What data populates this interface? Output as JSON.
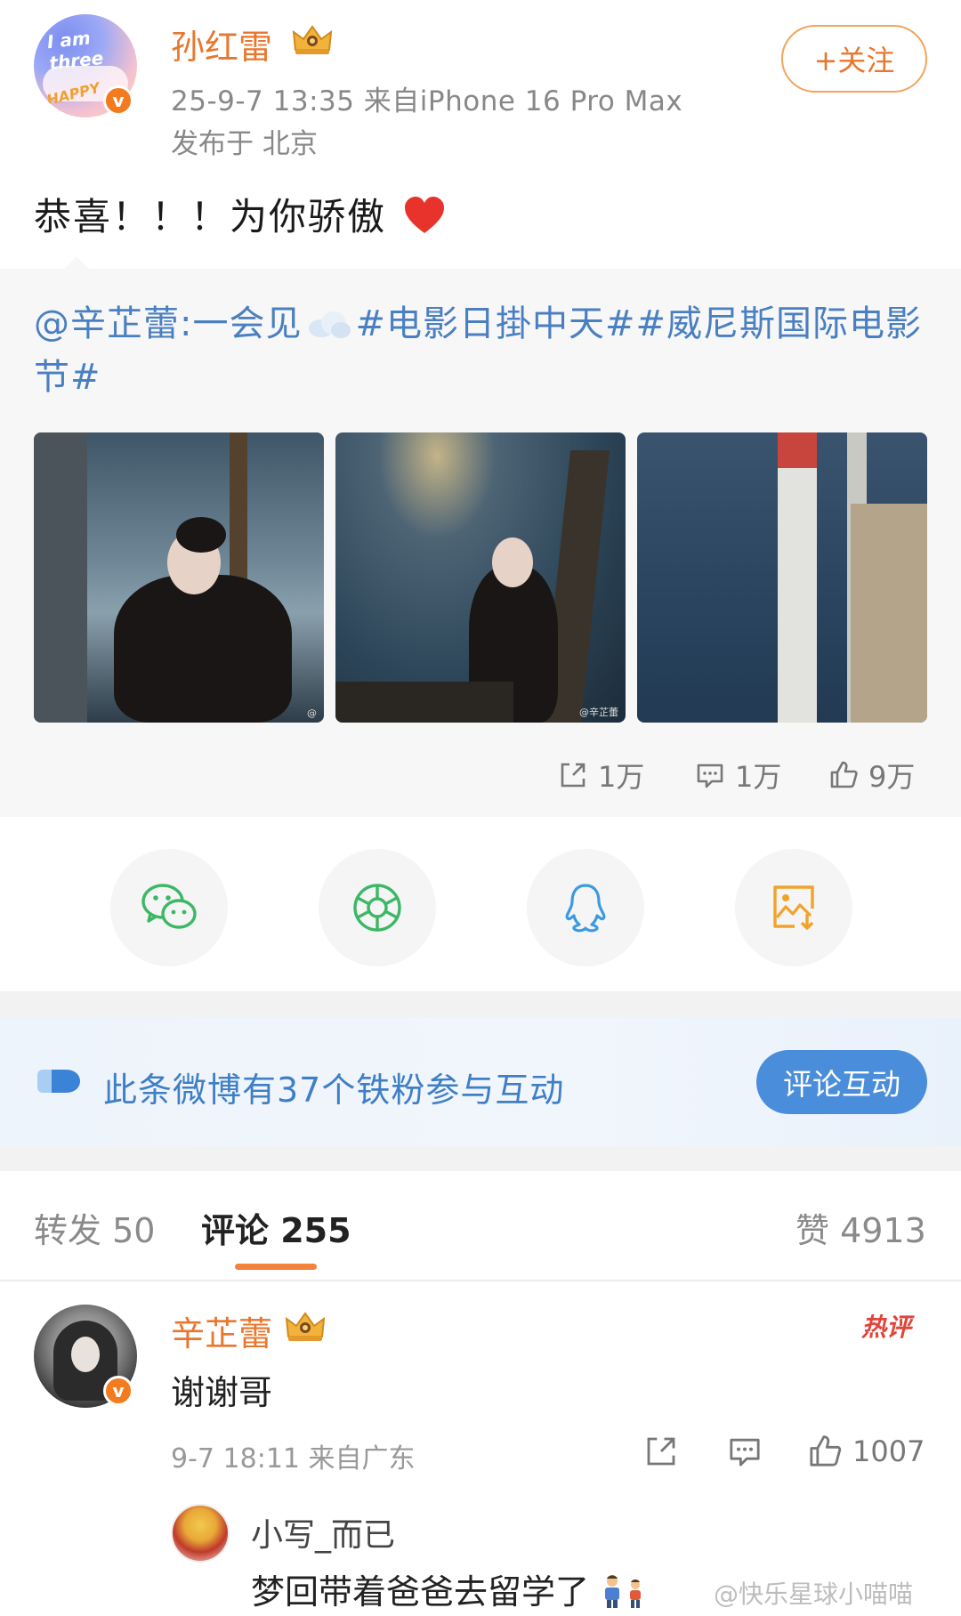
{
  "post": {
    "author": "孙红雷",
    "meta": "25-9-7 13:35  来自iPhone 16 Pro Max",
    "location": "发布于 北京",
    "follow_label": "+关注",
    "text": "恭喜！！！为你骄傲",
    "avatar_text_1": "I am three",
    "avatar_text_2": "HAPPY"
  },
  "repost": {
    "mention": "@辛芷蕾:一会见",
    "topics": "#电影日掛中天##威尼斯国际电影节#",
    "photos": [
      "photo-1",
      "photo-2",
      "photo-3"
    ],
    "photo_watermark_1": "@",
    "photo_watermark_2": "@辛芷蕾",
    "stats": {
      "reposts": "1万",
      "comments": "1万",
      "likes": "9万"
    }
  },
  "share": {
    "icons": [
      "wechat-icon",
      "moments-icon",
      "qq-icon",
      "save-image-icon"
    ]
  },
  "fans_banner": {
    "text": "此条微博有37个铁粉参与互动",
    "button": "评论互动"
  },
  "tabs": {
    "repost": "转发 50",
    "comment": "评论 255",
    "like": "赞 4913"
  },
  "comment": {
    "author": "辛芷蕾",
    "hot_label": "热评",
    "text": "谢谢哥",
    "meta": "9-7 18:11 来自广东",
    "likes": "1007"
  },
  "reply": {
    "author": "小写_而已",
    "text": "梦回带着爸爸去留学了"
  },
  "watermark": "@快乐星球小喵喵",
  "colors": {
    "accent": "#e8772e",
    "link": "#4a7fc1",
    "blue_button": "#4a8edb",
    "hot": "#e0453a"
  }
}
